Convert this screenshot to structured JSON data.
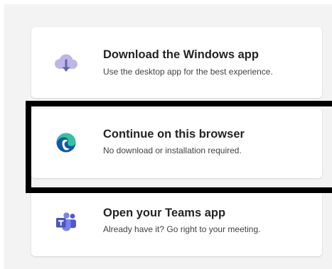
{
  "options": [
    {
      "id": "windows",
      "title": "Download the Windows app",
      "subtitle": "Use the desktop app for the best experience.",
      "icon": "cloud-download-icon"
    },
    {
      "id": "browser",
      "title": "Continue on this browser",
      "subtitle": "No download or installation required.",
      "icon": "edge-browser-icon"
    },
    {
      "id": "teams",
      "title": "Open your Teams app",
      "subtitle": "Already have it? Go right to your meeting.",
      "icon": "teams-icon"
    }
  ],
  "colors": {
    "accent": "#6264a7",
    "cloud": "#bdb6e6",
    "edge_blue": "#0c59a4",
    "edge_green": "#35c1a0",
    "highlight_border": "#000000"
  }
}
